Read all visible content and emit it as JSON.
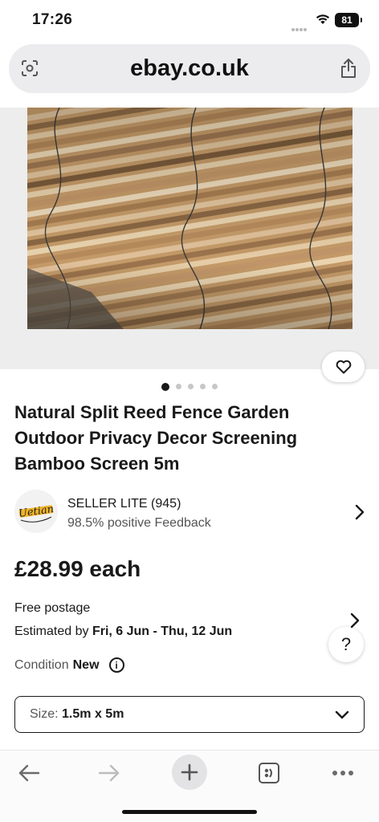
{
  "status_bar": {
    "time": "17:26",
    "battery": "81"
  },
  "browser": {
    "url": "ebay.co.uk"
  },
  "gallery": {
    "image_count": 5,
    "active_index": 0
  },
  "listing": {
    "title": "Natural Split Reed Fence Garden Outdoor Privacy Decor Screening Bamboo Screen 5m",
    "price": "£28.99 each"
  },
  "seller": {
    "logo_text": "Uetian",
    "name": "SELLER LITE (945)",
    "feedback": "98.5% positive Feedback"
  },
  "delivery": {
    "postage": "Free postage",
    "estimate_prefix": "Estimated by",
    "estimate_dates": "Fri, 6 Jun - Thu, 12 Jun"
  },
  "condition": {
    "label": "Condition",
    "value": "New"
  },
  "size": {
    "label": "Size:",
    "value": "1.5m x 5m"
  },
  "help": {
    "label": "?"
  },
  "colors": {
    "text": "#191919",
    "muted": "#555555",
    "url_bar": "#ececee"
  }
}
